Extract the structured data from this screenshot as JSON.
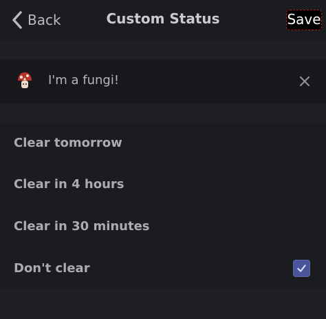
{
  "header": {
    "back_label": "Back",
    "title": "Custom Status",
    "save_label": "Save"
  },
  "status": {
    "emoji": "mushroom-icon",
    "text": "I'm a fungi!",
    "clear_icon": "close-icon"
  },
  "clear_options": [
    {
      "label": "Clear tomorrow",
      "selected": false
    },
    {
      "label": "Clear in 4 hours",
      "selected": false
    },
    {
      "label": "Clear in 30 minutes",
      "selected": false
    },
    {
      "label": "Don't clear",
      "selected": true
    }
  ],
  "colors": {
    "background": "#1f2023",
    "header_background": "#1b1c1f",
    "status_row_background": "#17181b",
    "checkbox_accent": "#4a5599",
    "save_button": "#000000",
    "save_outline": "#c21c1c"
  }
}
